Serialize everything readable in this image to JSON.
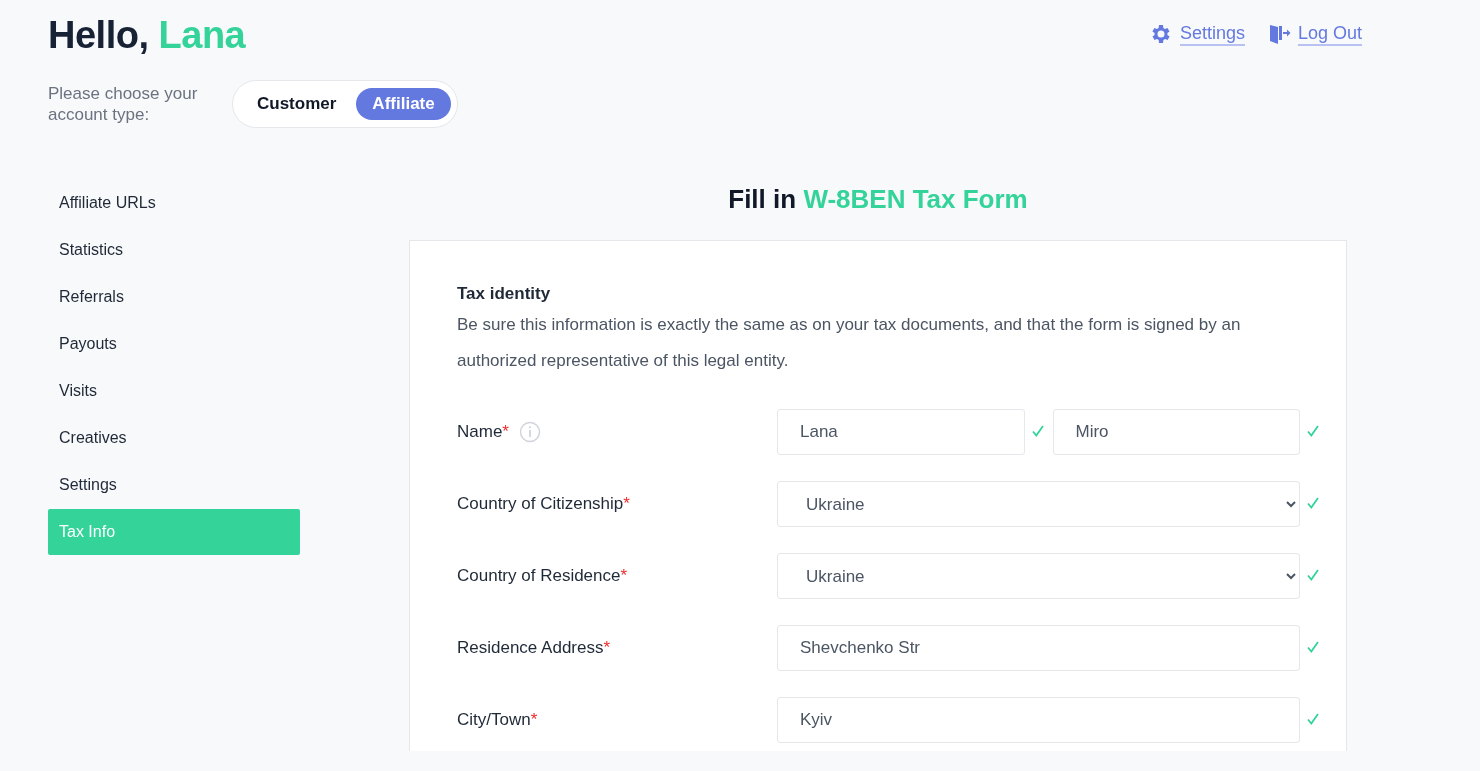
{
  "greeting": {
    "prefix": "Hello,",
    "name": "Lana"
  },
  "top_links": [
    {
      "kind": "settings",
      "label": "Settings"
    },
    {
      "kind": "logout",
      "label": "Log Out"
    }
  ],
  "account_type": {
    "prompt": "Please choose your account type:",
    "options": [
      {
        "label": "Customer",
        "selected": false
      },
      {
        "label": "Affiliate",
        "selected": true
      }
    ]
  },
  "sidebar": {
    "items": [
      {
        "label": "Affiliate URLs",
        "selected": false
      },
      {
        "label": "Statistics",
        "selected": false
      },
      {
        "label": "Referrals",
        "selected": false
      },
      {
        "label": "Payouts",
        "selected": false
      },
      {
        "label": "Visits",
        "selected": false
      },
      {
        "label": "Creatives",
        "selected": false
      },
      {
        "label": "Settings",
        "selected": false
      },
      {
        "label": "Tax Info",
        "selected": true
      }
    ]
  },
  "form": {
    "title_prefix": "Fill in",
    "title_highlight": "W-8BEN Tax Form",
    "section_title": "Tax identity",
    "description": "Be sure this information is exactly the same as on your tax documents, and that the form is signed by an authorized representative of this legal entity.",
    "rows": [
      {
        "kind": "text",
        "label": "Name",
        "required_mark": "*",
        "info": true,
        "fields": [
          {
            "value": "Lana",
            "valid": true
          },
          {
            "value": "Miro",
            "valid": true
          }
        ]
      },
      {
        "kind": "select",
        "label": "Country of Citizenship",
        "required_mark": "*",
        "fields": [
          {
            "value": "Ukraine",
            "valid": true
          }
        ]
      },
      {
        "kind": "select",
        "label": "Country of Residence",
        "required_mark": "*",
        "fields": [
          {
            "value": "Ukraine",
            "valid": true
          }
        ]
      },
      {
        "kind": "text",
        "label": "Residence Address",
        "required_mark": "*",
        "fields": [
          {
            "value": "Shevchenko Str",
            "valid": true
          }
        ]
      },
      {
        "kind": "text",
        "label": "City/Town",
        "required_mark": "*",
        "fields": [
          {
            "value": "Kyiv",
            "valid": true
          }
        ]
      }
    ]
  }
}
